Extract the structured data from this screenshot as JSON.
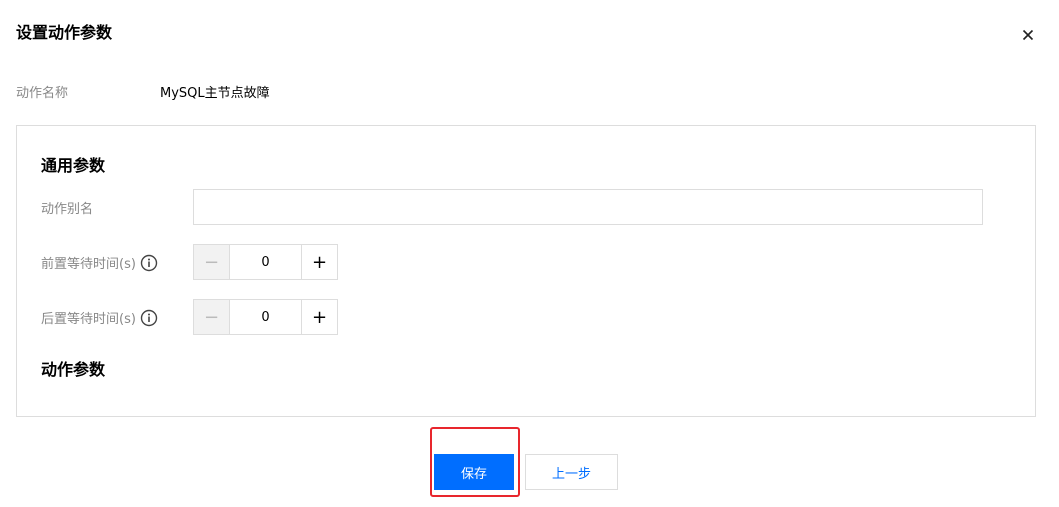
{
  "dialog": {
    "title": "设置动作参数",
    "close_icon": "close-icon"
  },
  "action_name": {
    "label": "动作名称",
    "value": "MySQL主节点故障"
  },
  "general_params": {
    "title": "通用参数",
    "alias": {
      "label": "动作别名",
      "value": "",
      "placeholder": ""
    },
    "pre_wait": {
      "label": "前置等待时间(s)",
      "info_icon": "info-icon",
      "minus": "−",
      "value": "0",
      "plus": "+"
    },
    "post_wait": {
      "label": "后置等待时间(s)",
      "info_icon": "info-icon",
      "minus": "−",
      "value": "0",
      "plus": "+"
    }
  },
  "action_params": {
    "title": "动作参数"
  },
  "footer": {
    "save_label": "保存",
    "prev_label": "上一步"
  },
  "colors": {
    "primary": "#006eff",
    "highlight": "#e8262d",
    "border": "#dddddd",
    "label": "#888888"
  }
}
